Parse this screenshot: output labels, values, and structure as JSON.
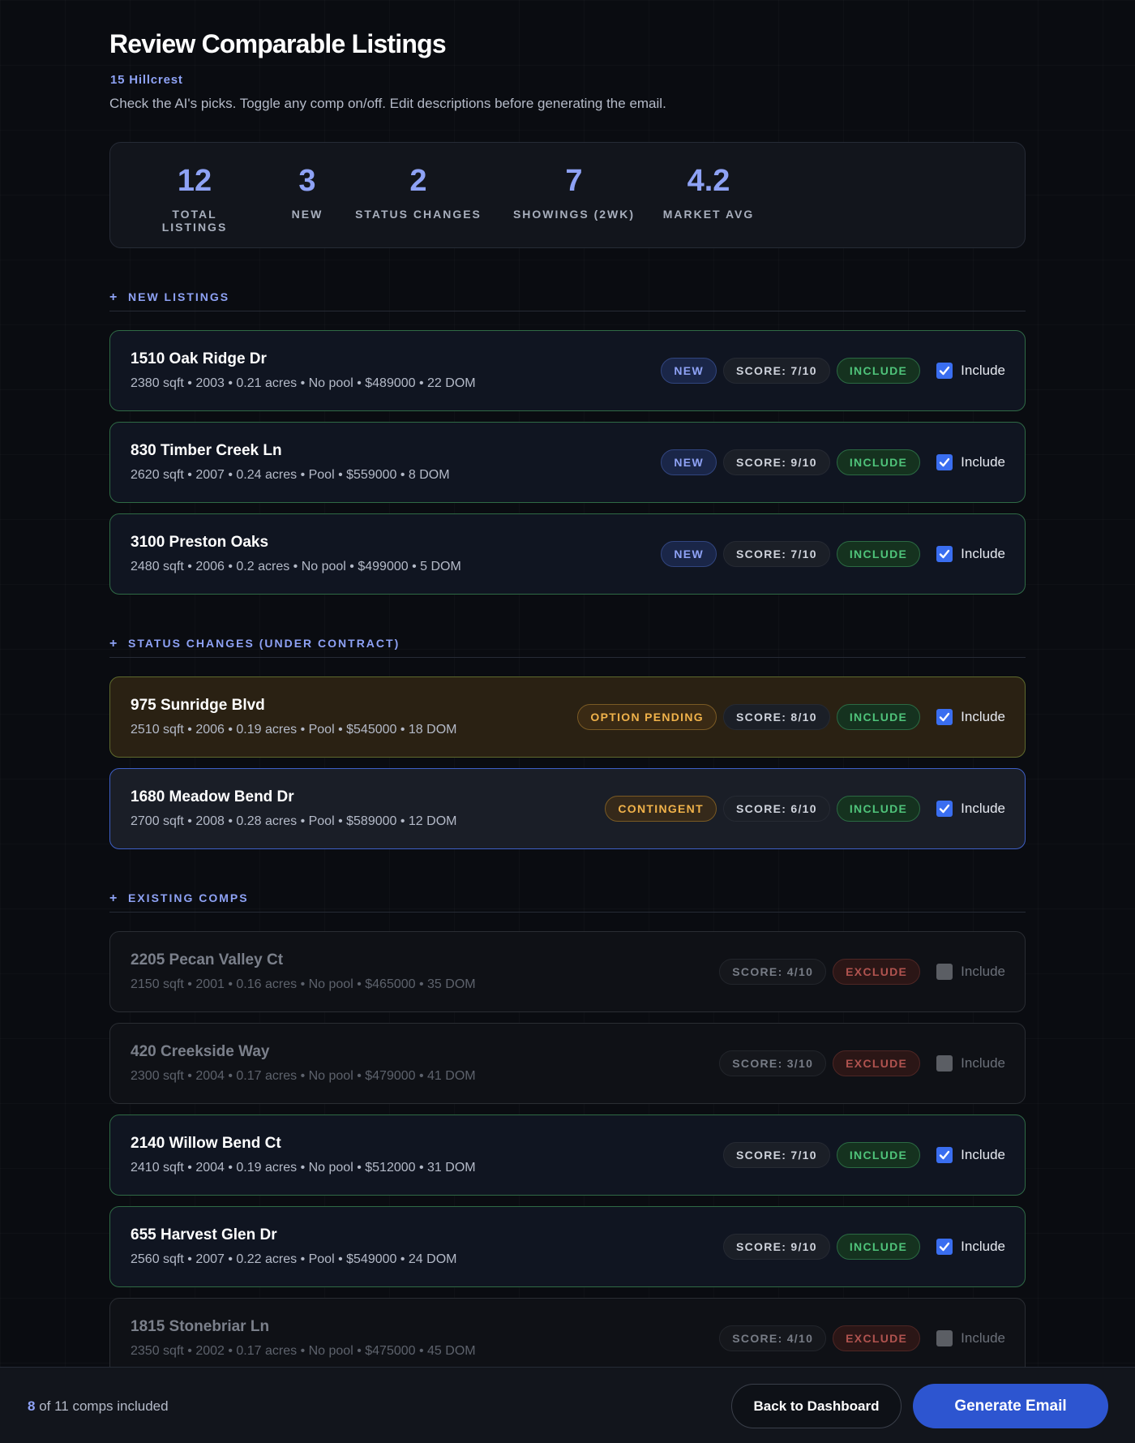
{
  "header": {
    "title": "Review Comparable Listings",
    "property": "15 Hillcrest",
    "subtitle": "Check the AI's picks. Toggle any comp on/off. Edit descriptions before generating the email."
  },
  "stats": [
    {
      "value": "12",
      "label": "TOTAL LISTINGS"
    },
    {
      "value": "3",
      "label": "NEW"
    },
    {
      "value": "2",
      "label": "STATUS CHANGES"
    },
    {
      "value": "7",
      "label": "SHOWINGS (2WK)"
    },
    {
      "value": "4.2",
      "label": "MARKET AVG"
    }
  ],
  "sections": {
    "new": {
      "icon": "+",
      "label": "NEW LISTINGS"
    },
    "status": {
      "icon": "+",
      "label": "STATUS CHANGES (UNDER CONTRACT)"
    },
    "existing": {
      "icon": "+",
      "label": "EXISTING COMPS"
    }
  },
  "checkbox_label": "Include",
  "listings": [
    {
      "address": "1510 Oak Ridge Dr",
      "details": "2380 sqft • 2003 • 0.21 acres • No pool • $489000 • 22 DOM",
      "tag": "NEW",
      "score": "SCORE: 7/10",
      "decision": "INCLUDE",
      "checked": true
    },
    {
      "address": "830 Timber Creek Ln",
      "details": "2620 sqft • 2007 • 0.24 acres • Pool • $559000 • 8 DOM",
      "tag": "NEW",
      "score": "SCORE: 9/10",
      "decision": "INCLUDE",
      "checked": true
    },
    {
      "address": "3100 Preston Oaks",
      "details": "2480 sqft • 2006 • 0.2 acres • No pool • $499000 • 5 DOM",
      "tag": "NEW",
      "score": "SCORE: 7/10",
      "decision": "INCLUDE",
      "checked": true
    },
    {
      "address": "975 Sunridge Blvd",
      "details": "2510 sqft • 2006 • 0.19 acres • Pool • $545000 • 18 DOM",
      "tag": "OPTION PENDING",
      "score": "SCORE: 8/10",
      "decision": "INCLUDE",
      "checked": true
    },
    {
      "address": "1680 Meadow Bend Dr",
      "details": "2700 sqft • 2008 • 0.28 acres • Pool • $589000 • 12 DOM",
      "tag": "CONTINGENT",
      "score": "SCORE: 6/10",
      "decision": "INCLUDE",
      "checked": true
    },
    {
      "address": "2205 Pecan Valley Ct",
      "details": "2150 sqft • 2001 • 0.16 acres • No pool • $465000 • 35 DOM",
      "tag": "",
      "score": "SCORE: 4/10",
      "decision": "EXCLUDE",
      "checked": false
    },
    {
      "address": "420 Creekside Way",
      "details": "2300 sqft • 2004 • 0.17 acres • No pool • $479000 • 41 DOM",
      "tag": "",
      "score": "SCORE: 3/10",
      "decision": "EXCLUDE",
      "checked": false
    },
    {
      "address": "2140 Willow Bend Ct",
      "details": "2410 sqft • 2004 • 0.19 acres • No pool • $512000 • 31 DOM",
      "tag": "",
      "score": "SCORE: 7/10",
      "decision": "INCLUDE",
      "checked": true
    },
    {
      "address": "655 Harvest Glen Dr",
      "details": "2560 sqft • 2007 • 0.22 acres • Pool • $549000 • 24 DOM",
      "tag": "",
      "score": "SCORE: 9/10",
      "decision": "INCLUDE",
      "checked": true
    },
    {
      "address": "1815 Stonebriar Ln",
      "details": "2350 sqft • 2002 • 0.17 acres • No pool • $475000 • 45 DOM",
      "tag": "",
      "score": "SCORE: 4/10",
      "decision": "EXCLUDE",
      "checked": false
    }
  ],
  "footer": {
    "included_count": "8",
    "count_text": " of 11 comps included",
    "back_label": "Back to Dashboard",
    "generate_label": "Generate Email"
  },
  "colors": {
    "accent": "#8ea2f5",
    "primary_button": "#2d55d0",
    "include_green": "#4fc37a",
    "exclude_red": "#b0534f",
    "warning_amber": "#f0b24a"
  }
}
